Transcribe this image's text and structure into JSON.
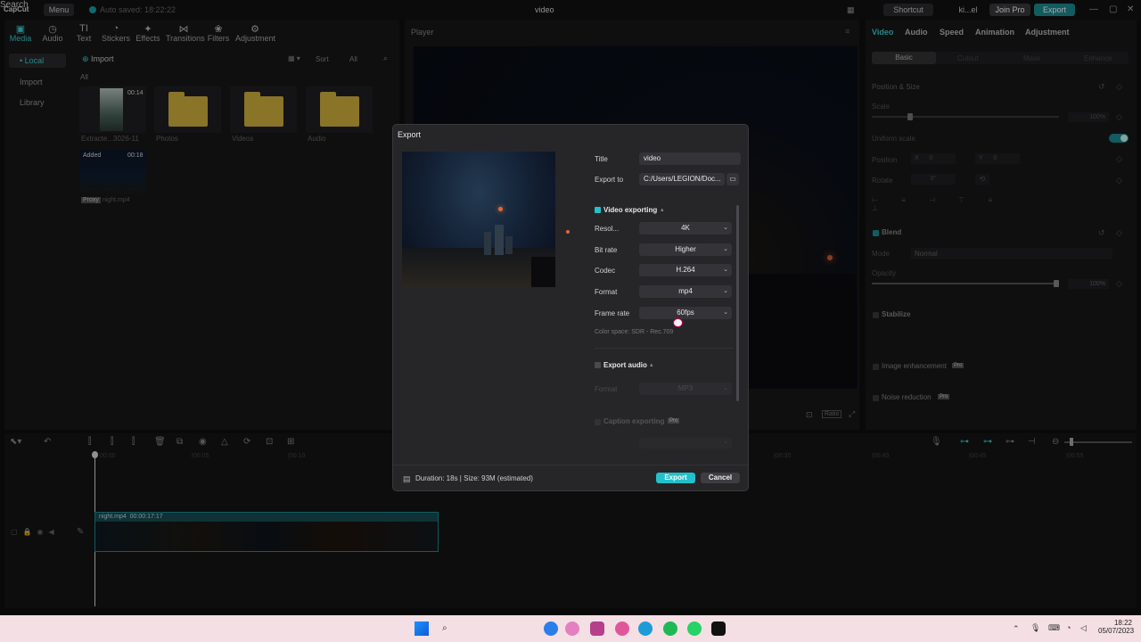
{
  "app": {
    "logo": "CapCut",
    "menu": "Menu",
    "saved": "Auto saved: 18:22:22",
    "title": "video",
    "shortcut": "Shortcut",
    "user": "ki...el",
    "join_pro": "Join Pro",
    "export": "Export"
  },
  "toolbar": [
    {
      "label": "Media",
      "icon": "media-icon"
    },
    {
      "label": "Audio",
      "icon": "audio-icon"
    },
    {
      "label": "Text",
      "icon": "text-icon"
    },
    {
      "label": "Stickers",
      "icon": "stickers-icon"
    },
    {
      "label": "Effects",
      "icon": "effects-icon"
    },
    {
      "label": "Transitions",
      "icon": "transitions-icon"
    },
    {
      "label": "Filters",
      "icon": "filters-icon"
    },
    {
      "label": "Adjustment",
      "icon": "adjustment-icon"
    }
  ],
  "media": {
    "side": [
      "• Local",
      "Import",
      "Library"
    ],
    "import": "Import",
    "all": "All",
    "sort": "Sort",
    "filter_all": "All",
    "thumbs": [
      {
        "label": "Extracte...3026-11",
        "duration": "00:14"
      },
      {
        "label": "Photos"
      },
      {
        "label": "Videos"
      },
      {
        "label": "Audio"
      }
    ],
    "clip": {
      "badge": "Added",
      "duration": "00:18",
      "name": "night.mp4",
      "tag": "Proxy"
    }
  },
  "player": {
    "title": "Player",
    "ratio": "Ratio"
  },
  "props": {
    "tabs": [
      "Video",
      "Audio",
      "Speed",
      "Animation",
      "Adjustment"
    ],
    "subtabs": [
      "Basic",
      "Cutout",
      "Mask",
      "Enhance"
    ],
    "position_size": "Position & Size",
    "scale": "Scale",
    "scale_value": "100%",
    "uniform_scale": "Uniform scale",
    "position": "Position",
    "pos_x_label": "X",
    "pos_x": "0",
    "pos_y_label": "Y",
    "pos_y": "0",
    "rotate": "Rotate",
    "rotate_value": "0°",
    "blend": "Blend",
    "mode": "Mode",
    "mode_value": "Normal",
    "opacity": "Opacity",
    "opacity_value": "100%",
    "stabilize": "Stabilize",
    "image_enhancement": "Image enhancement",
    "noise_reduction": "Noise reduction",
    "pro": "Pro"
  },
  "timeline": {
    "ruler": [
      "00:00",
      "|00:05",
      "|00:10",
      "|00:35",
      "|00:40",
      "|00:45",
      "|00:55"
    ],
    "clip_name": "night.mp4",
    "clip_duration": "00:00:17:17"
  },
  "export_dialog": {
    "title": "Export",
    "title_label": "Title",
    "title_value": "video",
    "export_to_label": "Export to",
    "export_to_value": "C:/Users/LEGION/Doc...",
    "video_exporting": "Video exporting",
    "resolution_label": "Resol...",
    "resolution": "4K",
    "bitrate_label": "Bit rate",
    "bitrate": "Higher",
    "codec_label": "Codec",
    "codec": "H.264",
    "format_label": "Format",
    "format": "mp4",
    "framerate_label": "Frame rate",
    "framerate": "60fps",
    "color_space": "Color space: SDR - Rec.709",
    "export_audio": "Export audio",
    "audio_format_label": "Format",
    "audio_format": "MP3",
    "caption_exporting": "Caption exporting",
    "pro": "Pro",
    "summary": "Duration: 18s | Size: 93M (estimated)",
    "export_btn": "Export",
    "cancel_btn": "Cancel"
  },
  "taskbar": {
    "search": "Search",
    "time": "18:22",
    "date": "05/07/2023"
  },
  "colors": {
    "accent": "#22c1c9",
    "bg": "#0f0f10",
    "modal": "#262629",
    "taskbar": "#f4dfe4"
  }
}
